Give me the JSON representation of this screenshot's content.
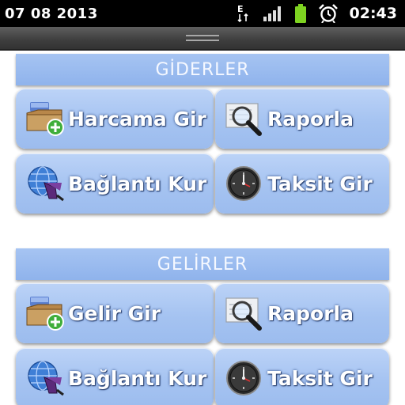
{
  "status_bar": {
    "date": "07 08 2013",
    "time": "02:43",
    "icons": [
      "data-transfer-icon",
      "signal-icon",
      "battery-icon",
      "alarm-clock-icon"
    ],
    "data_letter": "E"
  },
  "expenses": {
    "header": "GİDERLER",
    "buttons": [
      {
        "label": "Harcama Gir",
        "icon": "folder-add-icon"
      },
      {
        "label": "Raporla",
        "icon": "report-magnifier-icon"
      },
      {
        "label": "Bağlantı Kur",
        "icon": "connection-globe-icon"
      },
      {
        "label": "Taksit Gir",
        "icon": "clock-icon"
      }
    ]
  },
  "income": {
    "header": "GELİRLER",
    "buttons": [
      {
        "label": "Gelir Gir",
        "icon": "folder-add-icon"
      },
      {
        "label": "Raporla",
        "icon": "report-magnifier-icon"
      },
      {
        "label": "Bağlantı Kur",
        "icon": "connection-globe-icon"
      },
      {
        "label": "Taksit Gir",
        "icon": "clock-icon"
      }
    ]
  },
  "colors": {
    "tile": "#a5c3f1",
    "header": "#97b9ee",
    "label_text": "#ffffff",
    "status_bar": "#000000"
  }
}
